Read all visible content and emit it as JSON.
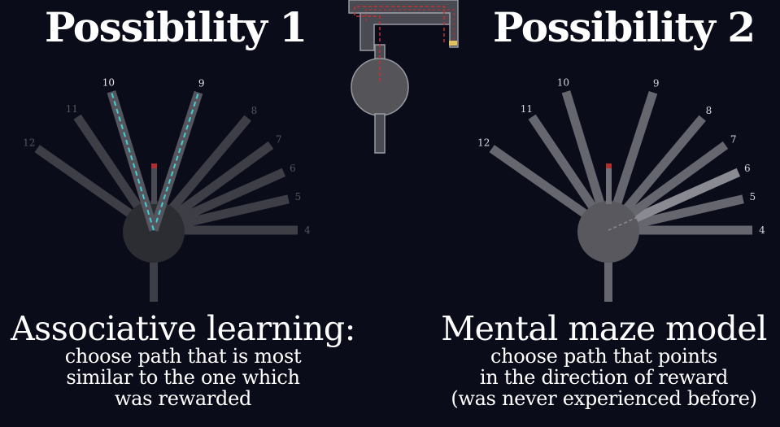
{
  "headings": {
    "left": "Possibility 1",
    "right": "Possibility 2"
  },
  "captions": {
    "left": {
      "title": "Associative learning:",
      "lines": [
        "choose path that is most",
        "similar to the one which",
        "was rewarded"
      ]
    },
    "right": {
      "title": "Mental maze model",
      "lines": [
        "choose path that points",
        "in the direction of reward",
        "(was never experienced before)"
      ]
    }
  },
  "arm_labels": [
    "4",
    "5",
    "6",
    "7",
    "8",
    "9",
    "10",
    "11",
    "12"
  ],
  "colors": {
    "background": "#0b0c1a",
    "arm_fill": "#4a4a52",
    "highlight_path": "#3fd0d8",
    "reward_path": "#c83030",
    "reward_food": "#e0c060",
    "start_marker": "#b03030"
  }
}
